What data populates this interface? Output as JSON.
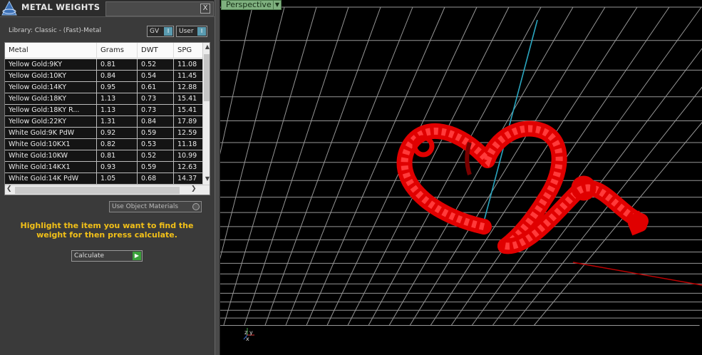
{
  "panel": {
    "title": "METAL WEIGHTS",
    "close": "X",
    "library_label": "Library: Classic - (Fast)-Metal",
    "gv_toggle": "GV",
    "user_toggle": "User",
    "toggle_mark": "I"
  },
  "table": {
    "columns": [
      "Metal",
      "Grams",
      "DWT",
      "SPG"
    ],
    "rows": [
      [
        "Yellow Gold:9KY",
        "0.81",
        "0.52",
        "11.08"
      ],
      [
        "Yellow Gold:10KY",
        "0.84",
        "0.54",
        "11.45"
      ],
      [
        "Yellow Gold:14KY",
        "0.95",
        "0.61",
        "12.88"
      ],
      [
        "Yellow Gold:18KY",
        "1.13",
        "0.73",
        "15.41"
      ],
      [
        "Yellow Gold:18KY R...",
        "1.13",
        "0.73",
        "15.41"
      ],
      [
        "Yellow Gold:22KY",
        "1.31",
        "0.84",
        "17.89"
      ],
      [
        "White Gold:9K PdW",
        "0.92",
        "0.59",
        "12.59"
      ],
      [
        "White Gold:10KX1",
        "0.82",
        "0.53",
        "11.18"
      ],
      [
        "White Gold:10KW",
        "0.81",
        "0.52",
        "10.99"
      ],
      [
        "White Gold:14KX1",
        "0.93",
        "0.59",
        "12.63"
      ],
      [
        "White Gold:14K PdW",
        "1.05",
        "0.68",
        "14.37"
      ]
    ]
  },
  "use_object_materials": "Use Object Materials",
  "hint": "Highlight the item you want to find the weight for then press calculate.",
  "calculate": "Calculate",
  "viewport": {
    "view_name": "Perspective",
    "axis_labels": {
      "x": "x",
      "y": "y",
      "z": "z"
    },
    "colors": {
      "grid": "#c8c8c8",
      "model": "#e00000",
      "y_axis": "#2aa6c0",
      "x_axis": "#c00000"
    }
  }
}
